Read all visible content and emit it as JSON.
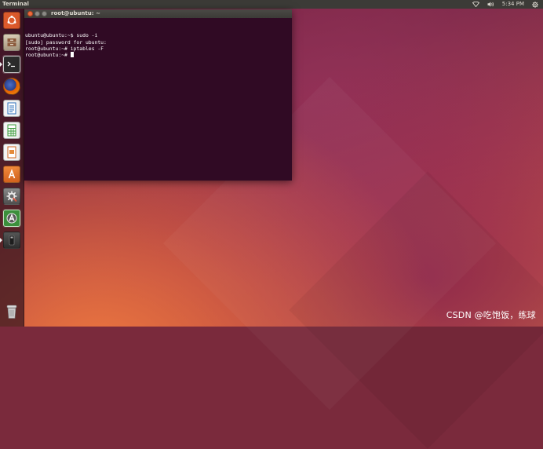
{
  "top_panel": {
    "app_title": "Terminal",
    "clock": "5:34 PM"
  },
  "launcher": {
    "items": [
      {
        "name": "dash-home",
        "icon": "ubuntu-logo-icon",
        "color": "#e0693d",
        "active": false
      },
      {
        "name": "files",
        "icon": "file-cabinet-icon",
        "color": "#c7b8a0",
        "active": false
      },
      {
        "name": "terminal",
        "icon": "terminal-icon",
        "color": "#2b2b2b",
        "active": true
      },
      {
        "name": "firefox",
        "icon": "firefox-icon",
        "color": "#e66000",
        "active": false
      },
      {
        "name": "writer",
        "icon": "writer-doc-icon",
        "color": "#2a6fbb",
        "active": false
      },
      {
        "name": "calc",
        "icon": "calc-sheet-icon",
        "color": "#3a9b3a",
        "active": false
      },
      {
        "name": "impress",
        "icon": "impress-slide-icon",
        "color": "#d0661f",
        "active": false
      },
      {
        "name": "software-center",
        "icon": "software-center-icon",
        "color": "#e57c2f",
        "active": false
      },
      {
        "name": "system-settings",
        "icon": "gear-wrench-icon",
        "color": "#6b6b6b",
        "active": false
      },
      {
        "name": "software-updater",
        "icon": "updater-icon",
        "color": "#3c8f3c",
        "active": false
      },
      {
        "name": "usb-drive",
        "icon": "usb-drive-icon",
        "color": "#3d3d3d",
        "active": false
      },
      {
        "name": "trash",
        "icon": "trash-icon",
        "color": "#8a8a8a",
        "active": false
      }
    ]
  },
  "terminal": {
    "title": "root@ubuntu: ~",
    "lines": [
      "ubuntu@ubuntu:~$ sudo -i",
      "[sudo] password for ubuntu:",
      "root@ubuntu:~# iptables -F",
      "root@ubuntu:~# "
    ],
    "background": "#300a24",
    "foreground": "#ffffff"
  },
  "watermark": "CSDN @吃饱饭，练球"
}
